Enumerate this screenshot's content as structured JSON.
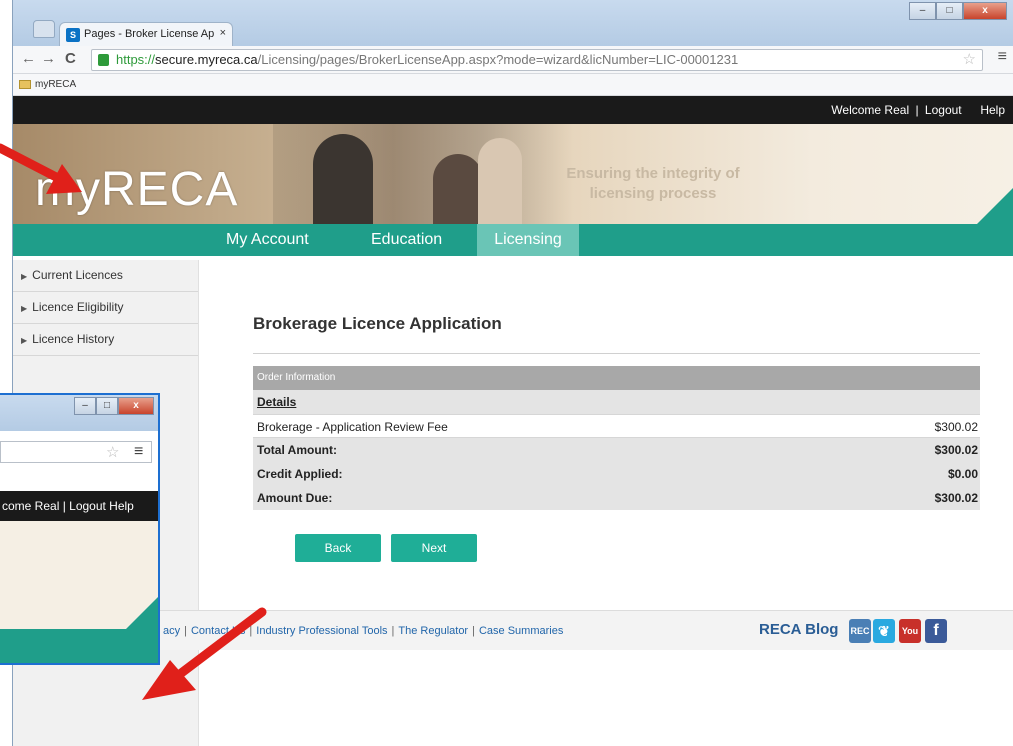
{
  "browser": {
    "tab_title": "Pages - Broker License Ap",
    "tab_close": "×",
    "url_scheme": "https://",
    "url_host": "secure.myreca.ca",
    "url_path": "/Licensing/pages/BrokerLicenseApp.aspx?mode=wizard&licNumber=LIC-00001231",
    "bookmark": "myRECA",
    "back": "←",
    "forward": "→",
    "reload": "C",
    "star": "☆",
    "menu": "≡"
  },
  "topbar": {
    "welcome": "Welcome Real",
    "separator": "|",
    "logout": "Logout",
    "help": "Help"
  },
  "banner": {
    "logo": "myRECA",
    "tagline_line1": "Ensuring the integrity of",
    "tagline_line2": "licensing process"
  },
  "nav": {
    "items": [
      {
        "label": "My Account"
      },
      {
        "label": "Education"
      },
      {
        "label": "Licensing"
      }
    ],
    "active": "Licensing"
  },
  "sidebar": {
    "items": [
      {
        "label": "Current Licences"
      },
      {
        "label": "Licence Eligibility"
      },
      {
        "label": "Licence History"
      }
    ]
  },
  "main": {
    "title": "Brokerage Licence Application",
    "order_header": "Order Information",
    "details_label": "Details",
    "fee_label": "Brokerage - Application Review Fee",
    "fee_value": "$300.02",
    "total_label": "Total Amount:",
    "total_value": "$300.02",
    "credit_label": "Credit Applied:",
    "credit_value": "$0.00",
    "due_label": "Amount Due:",
    "due_value": "$300.02",
    "back_label": "Back",
    "next_label": "Next"
  },
  "footer": {
    "links": [
      {
        "label": "acy"
      },
      {
        "label": "Contact Us"
      },
      {
        "label": "Industry Professional Tools"
      },
      {
        "label": "The Regulator"
      },
      {
        "label": "Case Summaries"
      }
    ],
    "blog": "RECA Blog",
    "social": {
      "rec": "REC",
      "youtube": "You"
    }
  },
  "inset": {
    "topbar_text": "come Real | Logout   Help"
  },
  "colors": {
    "teal": "#1f9e8a",
    "teal_active": "#6ac5b6",
    "button": "#1fae97",
    "callout": "#e0201a"
  }
}
